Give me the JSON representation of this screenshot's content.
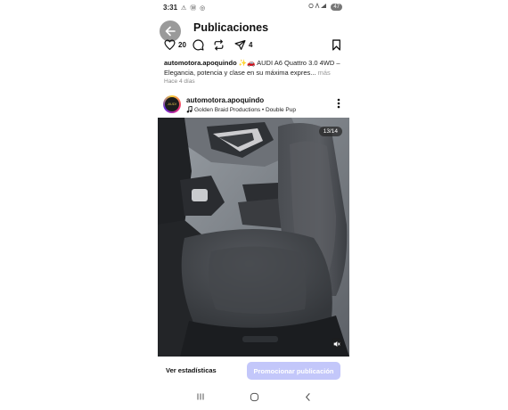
{
  "status_bar": {
    "time": "3:31",
    "left_icons": "⚠ Ⓦ ◎",
    "right_icons": "⏰ ᴗ ▲",
    "battery": "47"
  },
  "header": {
    "title": "Publicaciones",
    "back_icon": "arrow-left-icon"
  },
  "actions": {
    "likes": "20",
    "shares": "4"
  },
  "caption": {
    "username": "automotora.apoquindo",
    "emoji": "✨🚗",
    "text": " AUDI A6 Quattro 3.0 4WD – Elegancia, potencia y clase en su máxima expres...",
    "more": " más"
  },
  "time_ago": "Hace 4 días",
  "post": {
    "username": "automotora.apoquindo",
    "audio": "Golden Braid Productions • Double Pup",
    "avatar_text": "AUDI",
    "counter": "13/14"
  },
  "bottom": {
    "stats": "Ver estadísticas",
    "promote": "Promocionar publicación"
  },
  "colors": {
    "promote_button": "#c3c7fa",
    "seat_fabric": "#3d4045"
  }
}
